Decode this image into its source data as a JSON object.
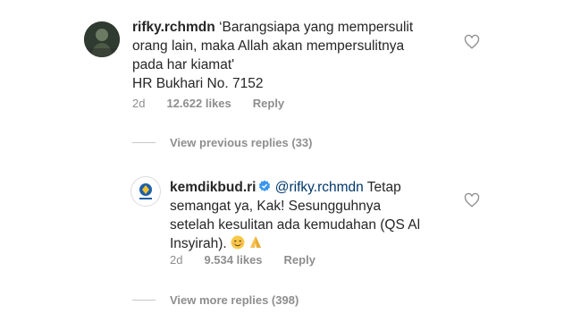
{
  "comment1": {
    "username": "rifky.rchmdn",
    "text_line1": "‘Barangsiapa yang mempersulit",
    "text_line2": "orang lain, maka Allah akan mempersulitnya",
    "text_line3": "pada har kiamat'",
    "text_line4": "HR Bukhari No. 7152",
    "age": "2d",
    "likes": "12.622 likes",
    "reply_label": "Reply"
  },
  "view_previous": "View previous replies (33)",
  "comment2": {
    "username": "kemdikbud.ri",
    "mention": "@rifky.rchmdn",
    "text_line1_rest": " Tetap",
    "text_line2": "semangat ya, Kak! Sesungguhnya",
    "text_line3": "setelah kesulitan ada kemudahan (QS Al",
    "text_line4": "Insyirah).",
    "age": "2d",
    "likes": "9.534 likes",
    "reply_label": "Reply"
  },
  "view_more": "View more replies (398)",
  "colors": {
    "text": "#262626",
    "secondary": "#8e8e8e",
    "mention": "#00376b",
    "verified": "#3897f0"
  },
  "icons": {
    "like": "heart-outline-icon",
    "verified": "verified-badge-icon",
    "emoji1": "smiling-face-emoji",
    "emoji2": "folded-hands-emoji"
  }
}
